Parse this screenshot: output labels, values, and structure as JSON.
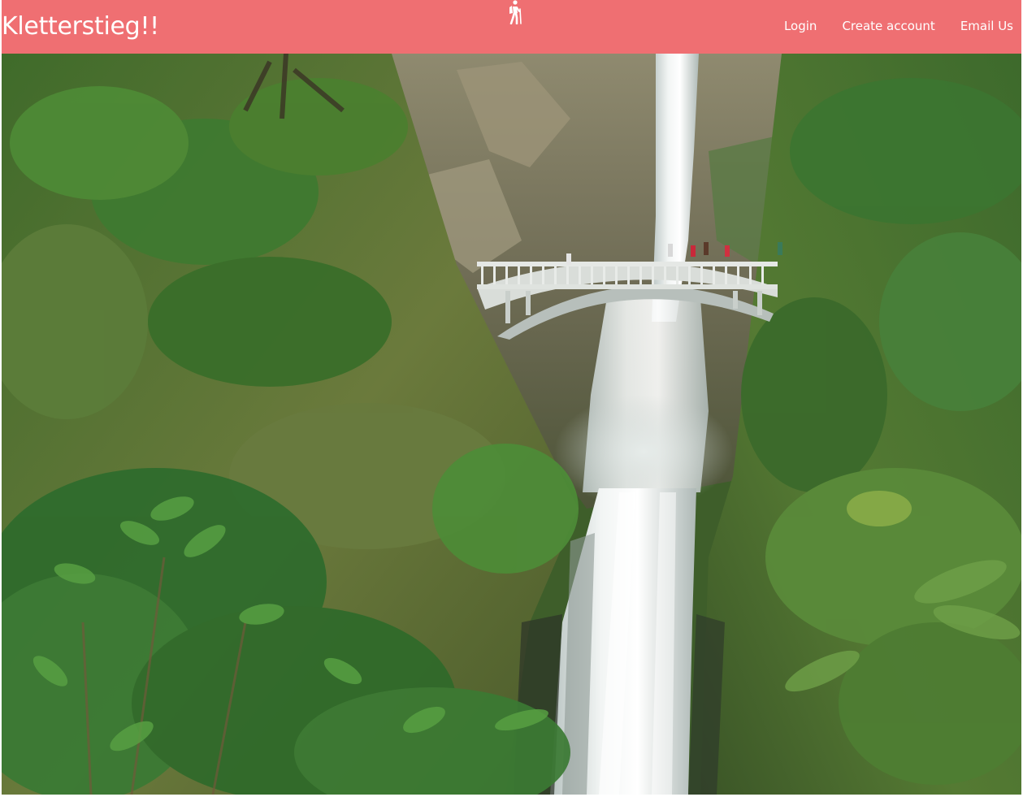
{
  "navbar": {
    "brand": "Kletterstieg!!",
    "logo_icon": "hiker-icon",
    "links": [
      {
        "label": "Login"
      },
      {
        "label": "Create account"
      },
      {
        "label": "Email Us"
      }
    ]
  },
  "hero": {
    "image_subject": "waterfall-with-arch-bridge-in-forest"
  },
  "colors": {
    "navbar_bg": "#ef6f72",
    "navbar_text": "#ffffff"
  }
}
